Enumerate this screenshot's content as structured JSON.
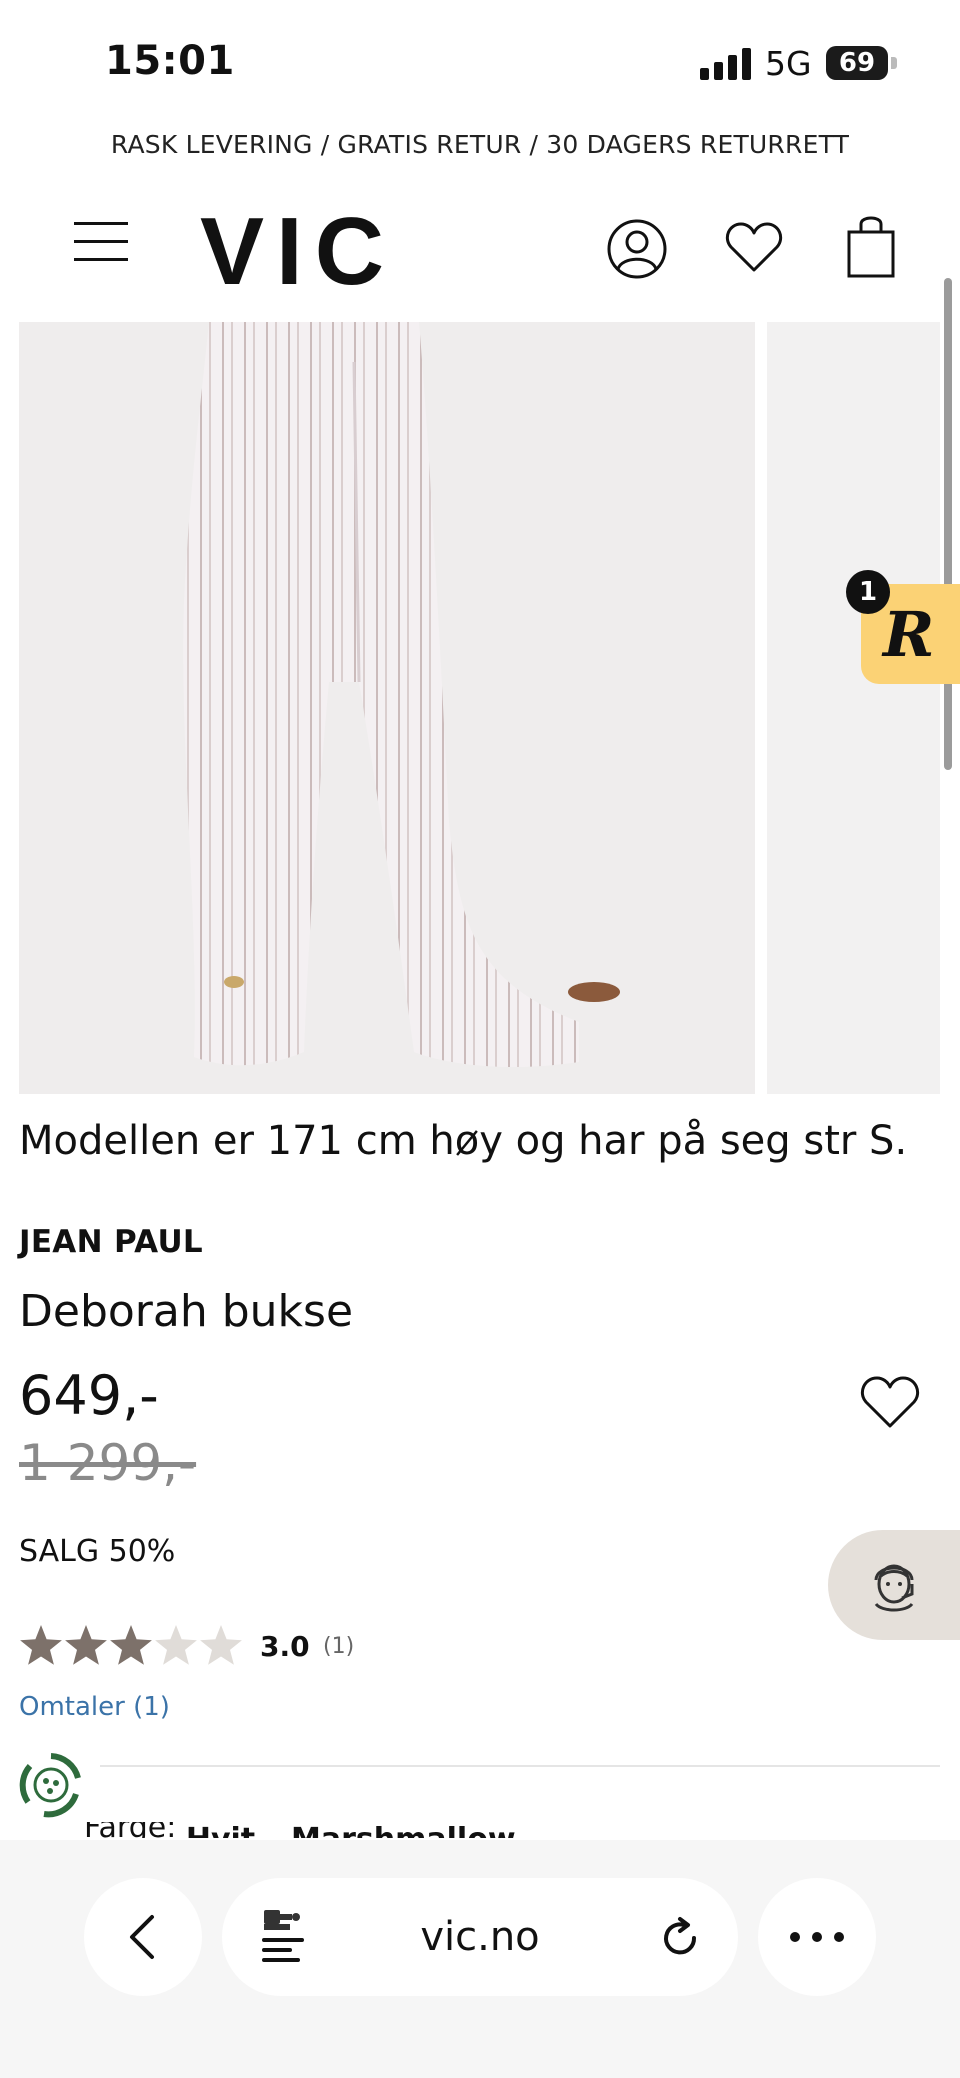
{
  "status_bar": {
    "time": "15:01",
    "network": "5G",
    "battery": "69"
  },
  "promo": {
    "text": "RASK LEVERING / GRATIS RETUR / 30 DAGERS RETURRETT"
  },
  "header": {
    "logo": "VIC",
    "icons": [
      "menu-icon",
      "account-icon",
      "heart-icon",
      "shopping-bag-icon"
    ]
  },
  "rewards": {
    "count": "1",
    "letter": "R"
  },
  "product": {
    "model_info": "Modellen er 171 cm høy og har på seg str S.",
    "brand": "JEAN PAUL",
    "name": "Deborah bukse",
    "price": "649,-",
    "old_price": "1 299,-",
    "sale": "SALG 50%",
    "rating": {
      "value": "3.0",
      "count": "(1)",
      "stars": 3,
      "max": 5
    },
    "reviews_link": "Omtaler (1)",
    "color_label": "Farge:",
    "color_value": "Hvit – Marshmallow"
  },
  "colors": {
    "accent": "#3b73a8",
    "rewards": "#fbd275",
    "star_filled": "#7d716a",
    "star_empty": "#e0dcd8"
  },
  "browser": {
    "url": "vic.no"
  }
}
